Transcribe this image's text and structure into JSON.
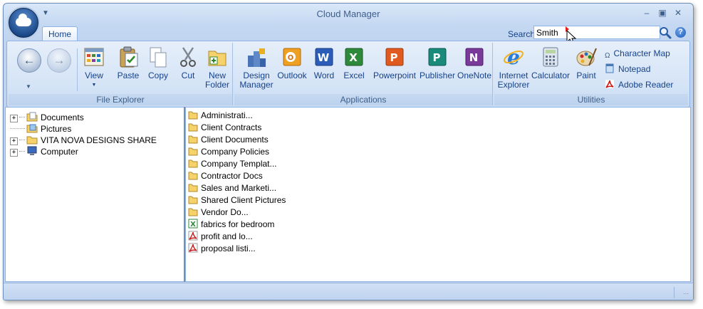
{
  "window": {
    "title": "Cloud Manager"
  },
  "tabs": [
    {
      "label": "Home"
    }
  ],
  "search": {
    "label": "Search",
    "value": "Smith"
  },
  "ribbon": {
    "file_explorer": {
      "label": "File Explorer",
      "buttons": [
        {
          "label": "View",
          "icon": "view-icon"
        },
        {
          "label": "Paste",
          "icon": "paste-icon"
        },
        {
          "label": "Copy",
          "icon": "copy-icon"
        },
        {
          "label": "Cut",
          "icon": "scissors-icon"
        },
        {
          "label_line1": "New",
          "label_line2": "Folder",
          "icon": "new-folder-icon"
        }
      ]
    },
    "applications": {
      "label": "Applications",
      "buttons": [
        {
          "label_line1": "Design",
          "label_line2": "Manager",
          "icon": "design-manager-icon"
        },
        {
          "label": "Outlook",
          "icon": "outlook-icon"
        },
        {
          "label": "Word",
          "icon": "word-icon"
        },
        {
          "label": "Excel",
          "icon": "excel-icon"
        },
        {
          "label": "Powerpoint",
          "icon": "powerpoint-icon"
        },
        {
          "label": "Publisher",
          "icon": "publisher-icon"
        },
        {
          "label": "OneNote",
          "icon": "onenote-icon"
        }
      ]
    },
    "utilities": {
      "label": "Utilities",
      "buttons": [
        {
          "label_line1": "Internet",
          "label_line2": "Explorer",
          "icon": "internet-explorer-icon"
        },
        {
          "label": "Calculator",
          "icon": "calculator-icon"
        },
        {
          "label": "Paint",
          "icon": "paint-icon"
        }
      ],
      "small_buttons": [
        {
          "label": "Character Map",
          "icon": "character-map-icon"
        },
        {
          "label": "Notepad",
          "icon": "notepad-icon"
        },
        {
          "label": "Adobe Reader",
          "icon": "adobe-reader-icon"
        }
      ]
    }
  },
  "tree": [
    {
      "label": "Documents",
      "expandable": true
    },
    {
      "label": "Pictures",
      "expandable": false
    },
    {
      "label": "VITA NOVA DESIGNS SHARE",
      "expandable": true
    },
    {
      "label": "Computer",
      "expandable": true
    }
  ],
  "files": [
    {
      "name": "Administrati...",
      "type": "folder"
    },
    {
      "name": "Client Contracts",
      "type": "folder"
    },
    {
      "name": "Client Documents",
      "type": "folder"
    },
    {
      "name": "Company Policies",
      "type": "folder"
    },
    {
      "name": "Company Templat...",
      "type": "folder"
    },
    {
      "name": "Contractor Docs",
      "type": "folder"
    },
    {
      "name": "Sales and Marketi...",
      "type": "folder"
    },
    {
      "name": "Shared Client Pictures",
      "type": "folder"
    },
    {
      "name": "Vendor Do...",
      "type": "folder"
    },
    {
      "name": "fabrics for bedroom",
      "type": "excel"
    },
    {
      "name": "profit and lo...",
      "type": "pdf"
    },
    {
      "name": "proposal listi...",
      "type": "pdf"
    }
  ]
}
